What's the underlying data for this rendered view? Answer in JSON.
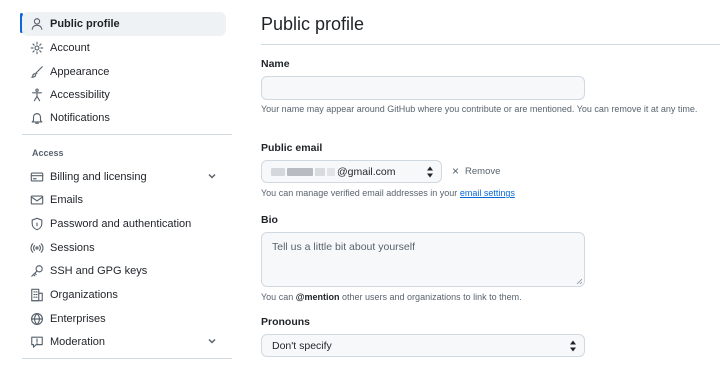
{
  "sidebar": {
    "items": [
      {
        "label": "Public profile",
        "icon": "person-icon"
      },
      {
        "label": "Account",
        "icon": "gear-icon"
      },
      {
        "label": "Appearance",
        "icon": "paintbrush-icon"
      },
      {
        "label": "Accessibility",
        "icon": "accessibility-icon"
      },
      {
        "label": "Notifications",
        "icon": "bell-icon"
      }
    ],
    "access_heading": "Access",
    "access_items": [
      {
        "label": "Billing and licensing",
        "icon": "credit-card-icon"
      },
      {
        "label": "Emails",
        "icon": "mail-icon"
      },
      {
        "label": "Password and authentication",
        "icon": "shield-lock-icon"
      },
      {
        "label": "Sessions",
        "icon": "broadcast-icon"
      },
      {
        "label": "SSH and GPG keys",
        "icon": "key-icon"
      },
      {
        "label": "Organizations",
        "icon": "organization-icon"
      },
      {
        "label": "Enterprises",
        "icon": "globe-icon"
      },
      {
        "label": "Moderation",
        "icon": "report-icon"
      }
    ]
  },
  "main": {
    "title": "Public profile",
    "name": {
      "label": "Name",
      "value": "",
      "hint": "Your name may appear around GitHub where you contribute or are mentioned. You can remove it at any time."
    },
    "public_email": {
      "label": "Public email",
      "selected_suffix": "@gmail.com",
      "remove_label": "Remove",
      "hint_prefix": "You can manage verified email addresses in your",
      "hint_link": "email settings"
    },
    "bio": {
      "label": "Bio",
      "placeholder": "Tell us a little bit about yourself",
      "hint_prefix": "You can",
      "hint_mention": "@mention",
      "hint_suffix": "other users and organizations to link to them."
    },
    "pronouns": {
      "label": "Pronouns",
      "selected": "Don't specify"
    }
  },
  "colors": {
    "accent": "#0969da",
    "text": "#1f2328",
    "muted": "#59636e",
    "border": "#d1d9e0",
    "input_bg": "#f6f8fa"
  }
}
